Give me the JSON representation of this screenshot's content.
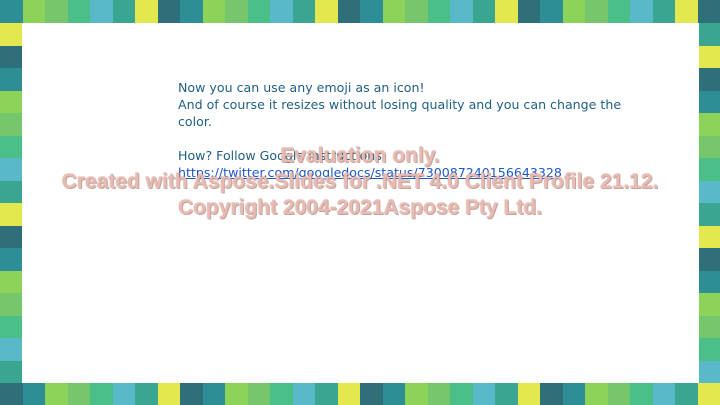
{
  "slide": {
    "line1": "Now you can use any emoji as an icon!",
    "line2": "And of course it resizes without losing quality and you can change the color.",
    "line3": "How? Follow Google instructions",
    "link": "https://twitter.com/googledocs/status/730087240156643328"
  },
  "watermark": {
    "line1": "Evaluation only.",
    "line2": "Created with Aspose.Slides for .NET 4.0 Client Profile 21.12.",
    "line3": "Copyright 2004-2021Aspose Pty Ltd."
  },
  "colors": {
    "text": "#1f5f84",
    "link": "#1e58c6",
    "palette": [
      "#2e8e95",
      "#4bbf88",
      "#e3e84e",
      "#8dd35a",
      "#5ab9c8",
      "#2f6f7a",
      "#76c66b",
      "#3aa692"
    ]
  }
}
